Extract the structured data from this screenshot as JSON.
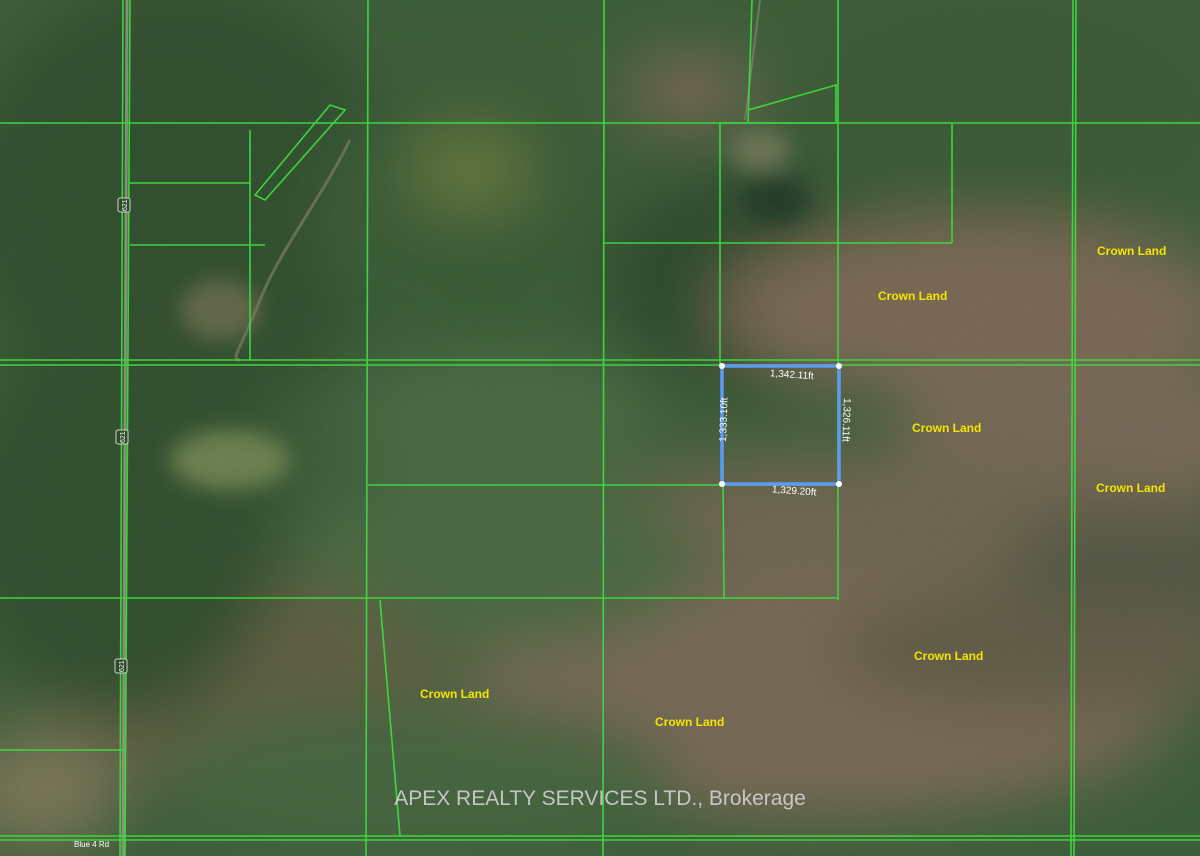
{
  "map": {
    "colors": {
      "parcel_line": "#3ddc3d",
      "selected_parcel": "#5b9bf0",
      "crown_label": "#f2e600",
      "measure_text": "#ffffff",
      "watermark": "#d8d8d8"
    },
    "selected_parcel": {
      "edges": {
        "top": "1,342.11ft",
        "right": "1,326.11ft",
        "bottom": "1,329.20ft",
        "left": "1,333.10ft"
      }
    },
    "crown_labels": [
      "Crown Land",
      "Crown Land",
      "Crown Land",
      "Crown Land",
      "Crown Land",
      "Crown Land",
      "Crown Land"
    ],
    "road_shields": [
      "621",
      "621",
      "621"
    ],
    "road_name": "Blue 4 Rd",
    "watermark": "APEX REALTY SERVICES LTD., Brokerage"
  }
}
